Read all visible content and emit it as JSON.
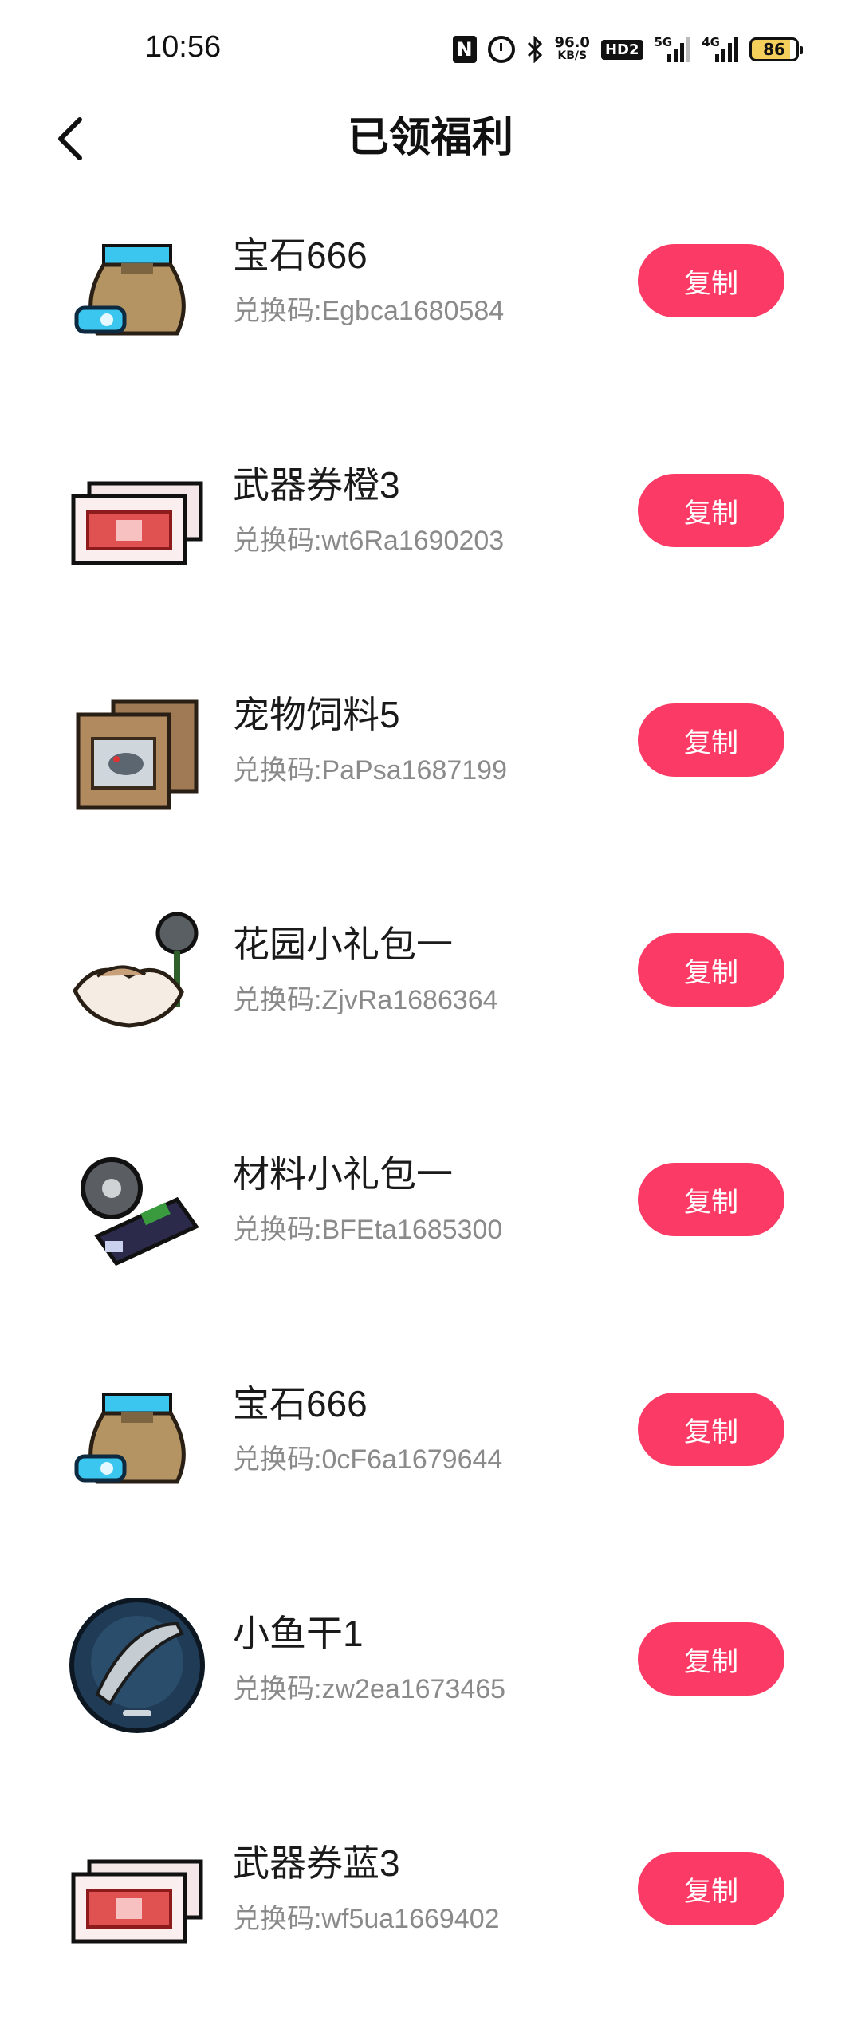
{
  "status_bar": {
    "time": "10:56",
    "nfc": "N",
    "net_speed_value": "96.0",
    "net_speed_unit": "KB/S",
    "hd_label": "HD2",
    "sim1_type": "5G",
    "sim2_type": "4G",
    "battery": "86"
  },
  "header": {
    "title": "已领福利",
    "back_icon": "chevron-left-icon"
  },
  "rewards": [
    {
      "name": "宝石666",
      "code": "兑换码:Egbca1680584",
      "button": "复制",
      "icon": "gem-bag-icon"
    },
    {
      "name": "武器券橙3",
      "code": "兑换码:wt6Ra1690203",
      "button": "复制",
      "icon": "weapon-ticket-orange-icon"
    },
    {
      "name": "宠物饲料5",
      "code": "兑换码:PaPsa1687199",
      "button": "复制",
      "icon": "pet-feed-icon"
    },
    {
      "name": "花园小礼包一",
      "code": "兑换码:ZjvRa1686364",
      "button": "复制",
      "icon": "garden-pack-icon"
    },
    {
      "name": "材料小礼包一",
      "code": "兑换码:BFEta1685300",
      "button": "复制",
      "icon": "material-pack-icon"
    },
    {
      "name": "宝石666",
      "code": "兑换码:0cF6a1679644",
      "button": "复制",
      "icon": "gem-bag-icon"
    },
    {
      "name": "小鱼干1",
      "code": "兑换码:zw2ea1673465",
      "button": "复制",
      "icon": "dried-fish-icon"
    },
    {
      "name": "武器券蓝3",
      "code": "兑换码:wf5ua1669402",
      "button": "复制",
      "icon": "weapon-ticket-blue-icon"
    }
  ],
  "colors": {
    "accent": "#fb3a66",
    "code_text": "#8a8a8a"
  }
}
